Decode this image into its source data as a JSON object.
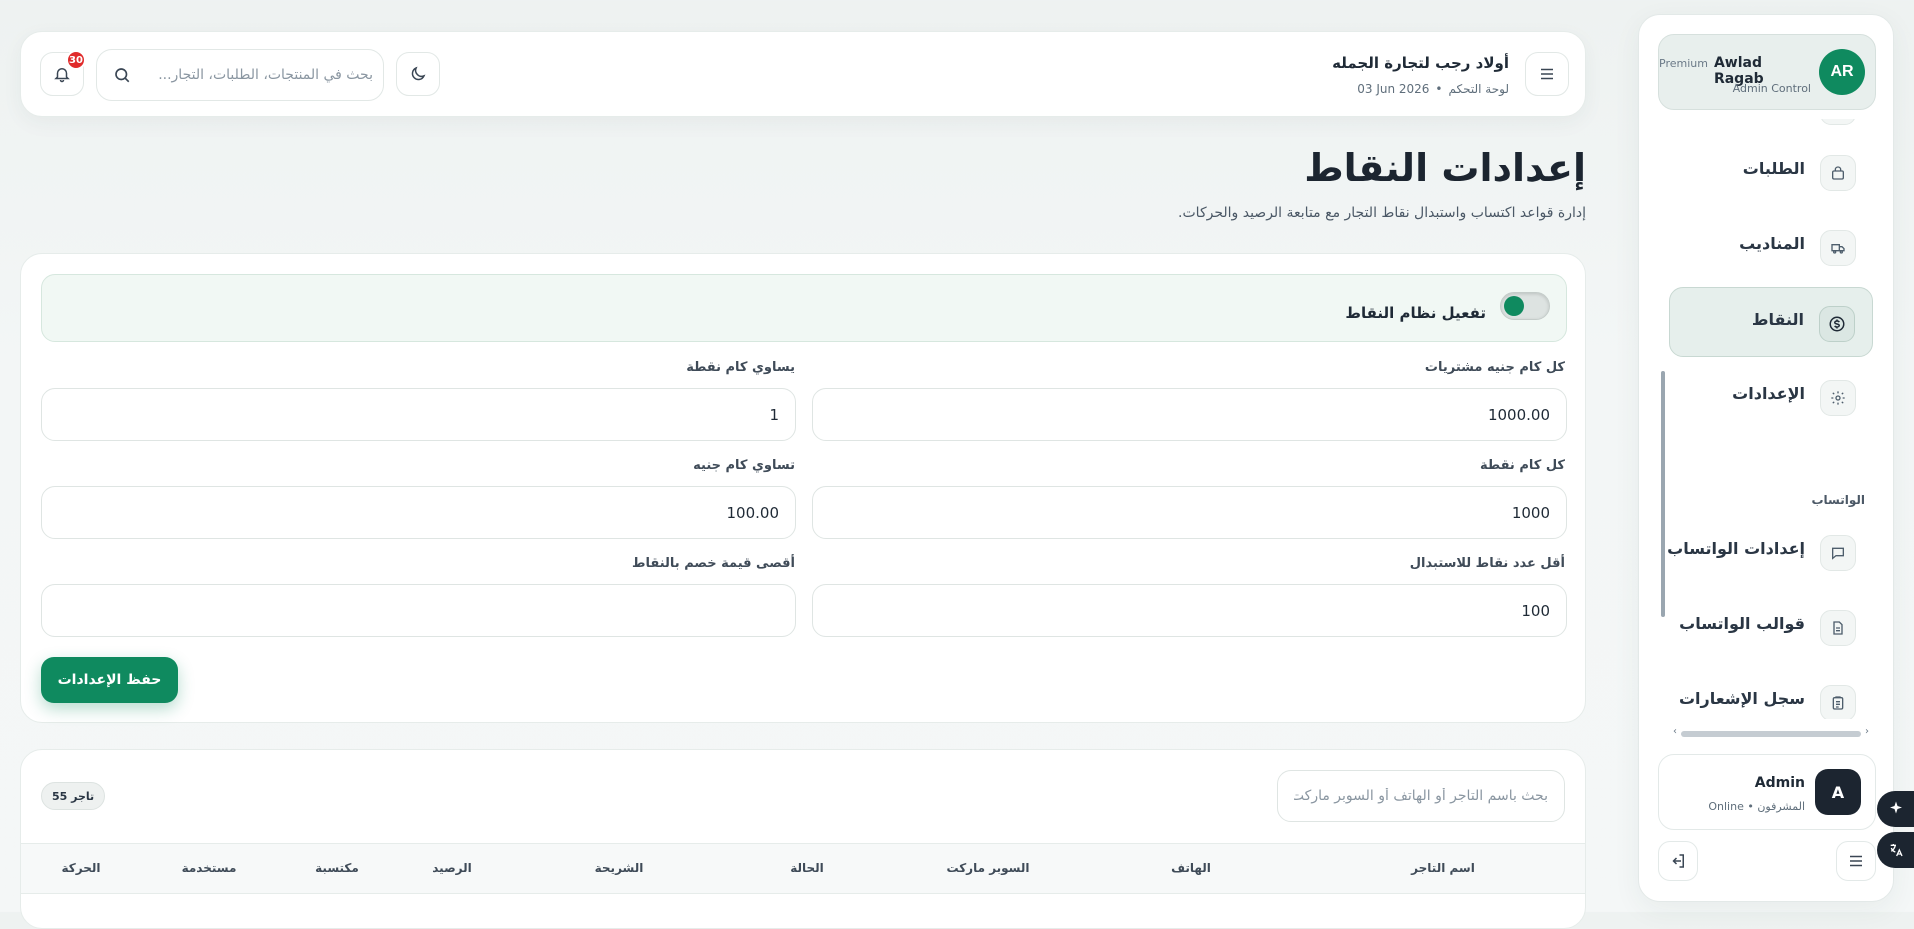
{
  "sidebar": {
    "profile": {
      "initials": "AR",
      "name": "Awlad Ragab",
      "badge": "Premium",
      "subtitle": "Admin Control"
    },
    "items": [
      {
        "label": "الطلبات",
        "icon": "bag-icon",
        "active": false
      },
      {
        "label": "المناديب",
        "icon": "truck-icon",
        "active": false
      },
      {
        "label": "النقاط",
        "icon": "coin-icon",
        "active": true
      },
      {
        "label": "الإعدادات",
        "icon": "gear-icon",
        "active": false
      }
    ],
    "section_whatsapp": "الواتساب",
    "whatsapp_items": [
      {
        "label": "إعدادات الواتساب",
        "icon": "chat-icon"
      },
      {
        "label": "قوالب الواتساب",
        "icon": "document-icon"
      },
      {
        "label": "سجل الإشعارات",
        "icon": "clipboard-icon"
      }
    ],
    "admin": {
      "initial": "A",
      "name": "Admin",
      "status": "Online",
      "role": "المشرفون"
    }
  },
  "topbar": {
    "store_name": "أولاد رجب لتجارة الجمله",
    "breadcrumb": "لوحة التحكم",
    "date": "03 Jun 2026",
    "search_placeholder": "بحث في المنتجات، الطلبات، التجار...",
    "notifications_count": "30"
  },
  "page": {
    "title": "إعدادات النقاط",
    "subtitle": "إدارة قواعد اكتساب واستبدال نقاط التجار مع متابعة الرصيد والحركات."
  },
  "settings": {
    "toggle_label": "تفعيل نظام النقاط",
    "toggle_on": true,
    "fields": {
      "spend_per": {
        "label": "كل كام جنيه مشتريات",
        "value": "1000.00"
      },
      "points_earned": {
        "label": "يساوي كام نقطة",
        "value": "1"
      },
      "points_per": {
        "label": "كل كام نقطة",
        "value": "1000"
      },
      "pounds_value": {
        "label": "تساوي كام جنيه",
        "value": "100.00"
      },
      "min_redeem": {
        "label": "أقل عدد نقاط للاستبدال",
        "value": "100"
      },
      "max_discount": {
        "label": "أقصى قيمة خصم بالنقاط",
        "value": ""
      }
    },
    "save_label": "حفظ الإعدادات"
  },
  "table": {
    "search_placeholder": "بحث باسم التاجر أو الهاتف أو السوبر ماركت",
    "count_label": "55 تاجر",
    "columns": [
      "اسم التاجر",
      "الهاتف",
      "السوبر ماركت",
      "الحالة",
      "الشريحة",
      "الرصيد",
      "مكتسبة",
      "مستخدمة",
      "الحركة"
    ]
  },
  "colors": {
    "accent": "#0f8a5f",
    "badge": "#e02b2b",
    "dark": "#1c2530"
  }
}
